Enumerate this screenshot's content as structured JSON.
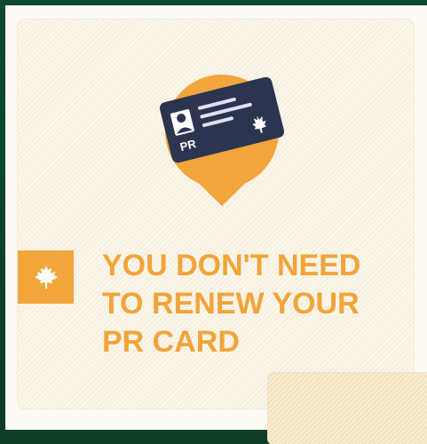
{
  "card": {
    "headline_lines": [
      "YOU DON'T NEED",
      "TO RENEW YOUR",
      "PR CARD"
    ],
    "pr_card_label": "PR"
  },
  "icons": {
    "pin": "location-pin-icon",
    "pr_card": "pr-card-icon",
    "maple_leaf": "maple-leaf-icon"
  },
  "colors": {
    "accent_orange": "#f2a43a",
    "card_navy": "#2c3450",
    "card_background": "#fbf6ea",
    "frame_green": "#0e3d28"
  }
}
